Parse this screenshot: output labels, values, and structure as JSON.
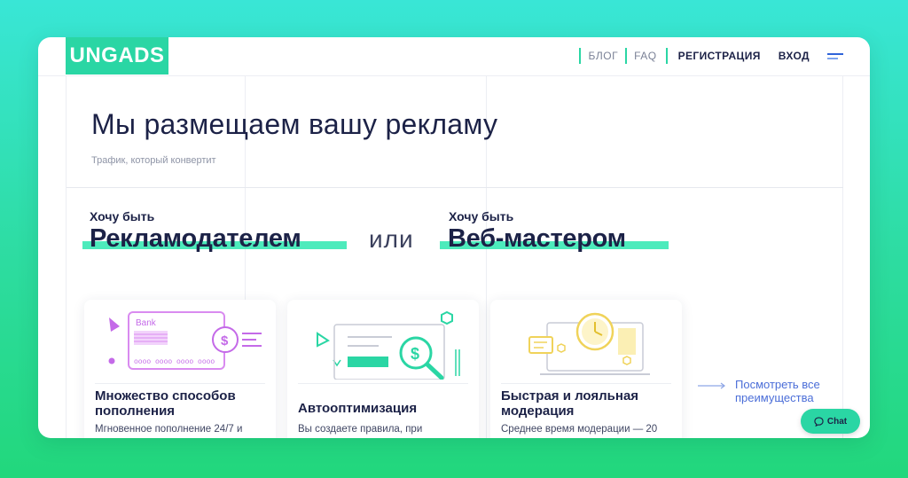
{
  "header": {
    "logo": "UNGADS",
    "nav": {
      "blog": "БЛОГ",
      "faq": "FAQ",
      "register": "РЕГИСТРАЦИЯ",
      "login": "ВХОД"
    }
  },
  "hero": {
    "title": "Мы размещаем вашу рекламу",
    "subtitle": "Трафик, который конвертит"
  },
  "choice": {
    "left_label": "Хочу быть",
    "left_big": "Рекламодателем",
    "or": "или",
    "right_label": "Хочу быть",
    "right_big": "Веб-мастером"
  },
  "cards": [
    {
      "title": "Множество способов пополнения",
      "desc": "Мгновенное пополнение 24/7 и",
      "illus_text": "Bank",
      "illus_digits": "oooo oooo oooo oooo"
    },
    {
      "title": "Автооптимизация",
      "desc": "Вы создаете правила, при"
    },
    {
      "title": "Быстрая и лояльная модерация",
      "desc": "Среднее время модерации — 20"
    }
  ],
  "more": {
    "label": "Посмотреть все преимущества"
  },
  "chat": {
    "label": "Chat"
  },
  "colors": {
    "accent": "#2ad6a4",
    "primary_text": "#1c2247",
    "link": "#4b6ed8"
  }
}
